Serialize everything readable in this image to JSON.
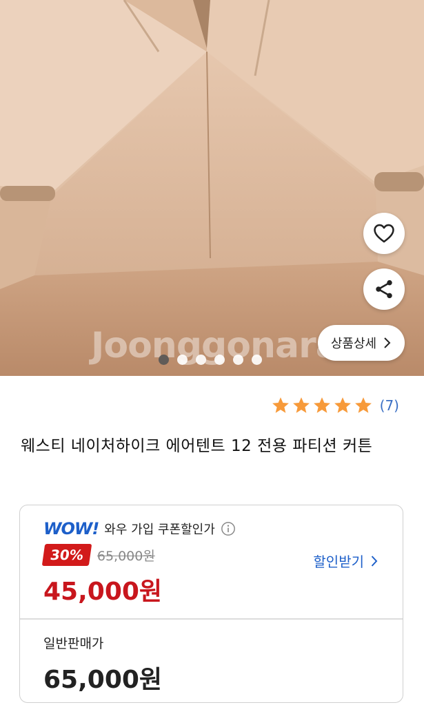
{
  "gallery": {
    "watermark": "Joonggonara",
    "detail_button_label": "상품상세",
    "total_images": 6,
    "active_index": 0
  },
  "rating": {
    "stars": 5,
    "count_text": "(7)",
    "star_color": "#f79a3a"
  },
  "product": {
    "title": "웨스티 네이처하이크 에어텐트 12 전용 파티션 커튼"
  },
  "wow_price": {
    "logo": "WOW!",
    "label": "와우 가입 쿠폰할인가",
    "discount_badge": "30%",
    "original_price": "65,000원",
    "price": "45,000원",
    "coupon_link": "할인받기",
    "accent_color": "#1d5fc9",
    "price_color": "#c8161d"
  },
  "normal_price": {
    "label": "일반판매가",
    "price": "65,000원"
  },
  "icons": {
    "like": "heart-icon",
    "share": "share-icon",
    "chevron": "chevron-right-icon",
    "info": "info-icon",
    "star": "star-icon"
  }
}
